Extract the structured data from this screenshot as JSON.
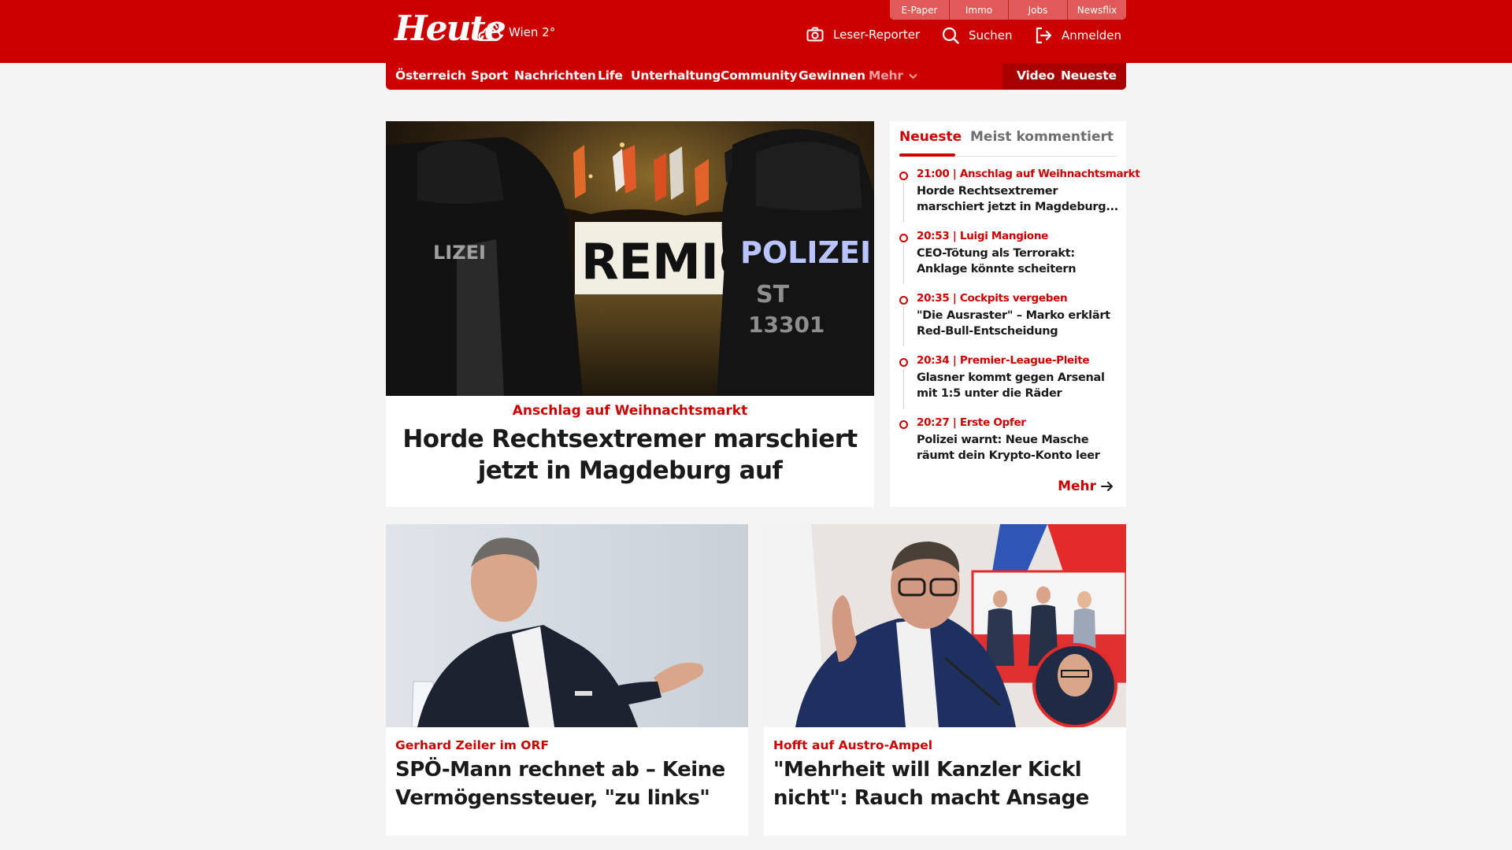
{
  "utility_tabs": [
    "E-Paper",
    "Immo",
    "Jobs",
    "Newsflix"
  ],
  "header": {
    "logo": "Heute",
    "weather": "Wien 2°",
    "leser_reporter": "Leser-Reporter",
    "search": "Suchen",
    "login": "Anmelden"
  },
  "nav": {
    "items": [
      "Österreich",
      "Sport",
      "Nachrichten",
      "Life",
      "Unterhaltung",
      "Community",
      "Gewinnen"
    ],
    "more": "Mehr",
    "video": "Video",
    "newest": "Neueste"
  },
  "lead": {
    "kicker": "Anschlag auf Weihnachtsmarkt",
    "title": "Horde Rechtsextremer marschiert jetzt in Magdeburg auf",
    "image_text": {
      "banner": "REMIGR",
      "police_left": "LIZEI",
      "police_right": "POLIZEI",
      "unit": "ST",
      "number": "13301"
    }
  },
  "newest": {
    "tabs": [
      "Neueste",
      "Meist kommentiert"
    ],
    "items": [
      {
        "meta": "21:00 | Anschlag auf Weihnachtsmarkt",
        "title": "Horde Rechtsextremer marschiert jetzt in Magdeburg..."
      },
      {
        "meta": "20:53 | Luigi Mangione",
        "title": "CEO-Tötung als Terrorakt: Anklage könnte scheitern"
      },
      {
        "meta": "20:35 | Cockpits vergeben",
        "title": "\"Die Ausraster\" – Marko erklärt Red-Bull-Entscheidung"
      },
      {
        "meta": "20:34 | Premier-League-Pleite",
        "title": "Glasner kommt gegen Arsenal mit 1:5 unter die Räder"
      },
      {
        "meta": "20:27 | Erste Opfer",
        "title": "Polizei warnt: Neue Masche räumt dein Krypto-Konto leer"
      }
    ],
    "more": "Mehr"
  },
  "cards": [
    {
      "kicker": "Gerhard Zeiler im ORF",
      "title": "SPÖ-Mann rechnet ab – Keine Vermögenssteuer, \"zu links\""
    },
    {
      "kicker": "Hofft auf Austro-Ampel",
      "title": "\"Mehrheit will Kanzler Kickl nicht\": Rauch macht Ansage"
    }
  ],
  "colors": {
    "brand_red": "#cc0000",
    "nav_dark_red": "#a80000",
    "utility_tab": "#e05a5a",
    "page_background": "#f4f4f4",
    "text": "#1a1a1a"
  },
  "icons": {
    "weather": "partly-cloudy-icon",
    "leser_reporter": "camera-icon",
    "search": "search-icon",
    "login": "login-icon",
    "more_nav": "chevron-down-icon",
    "more_list": "arrow-right-icon"
  }
}
